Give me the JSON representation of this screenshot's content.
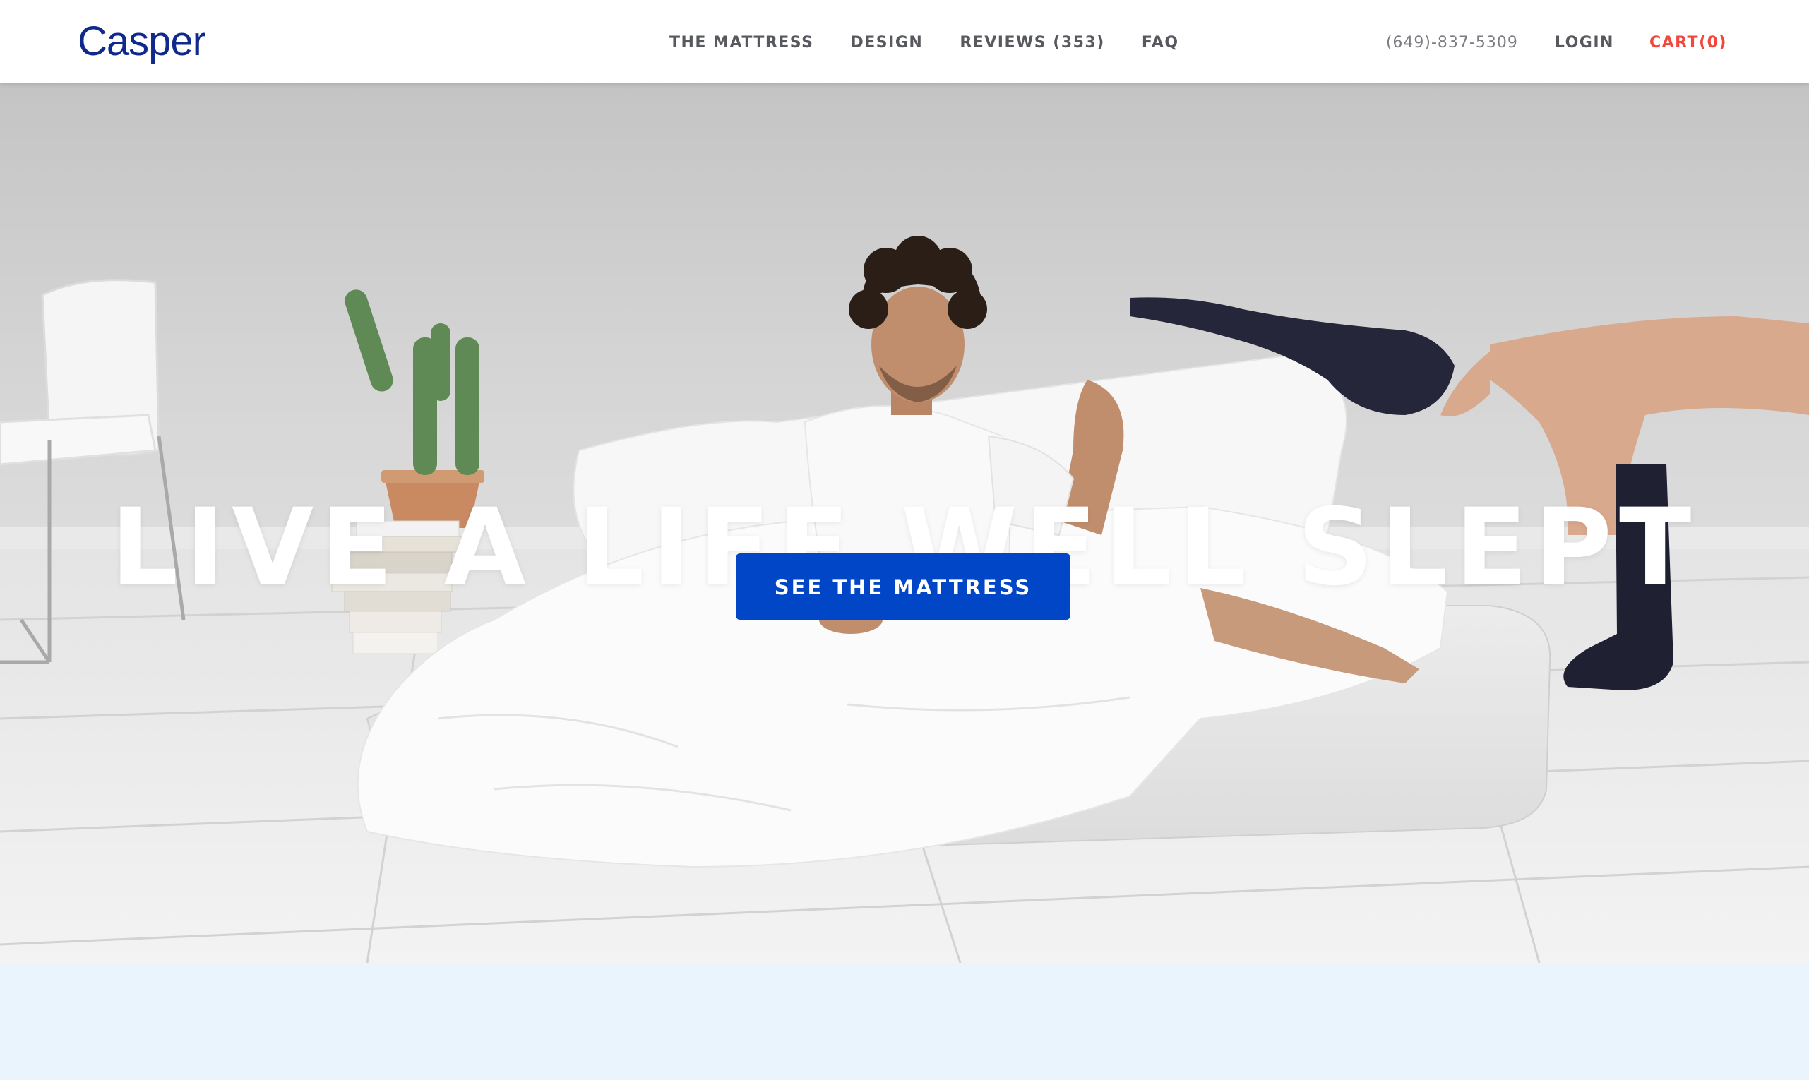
{
  "brand": {
    "logo_text": "Casper",
    "logo_color": "#0f2a8c"
  },
  "nav": {
    "items": [
      {
        "label": "THE MATTRESS"
      },
      {
        "label": "DESIGN"
      },
      {
        "label": "REVIEWS (353)"
      },
      {
        "label": "FAQ"
      }
    ],
    "phone": "(649)-837-5309",
    "login_label": "LOGIN",
    "cart_label": "CART(0)",
    "cart_color": "#f2473c"
  },
  "hero": {
    "headline": "LIVE A LIFE WELL SLEPT",
    "cta_label": "SEE THE MATTRESS",
    "cta_color": "#0046c6"
  },
  "colors": {
    "bottom_section_bg": "#eaf4fc"
  }
}
